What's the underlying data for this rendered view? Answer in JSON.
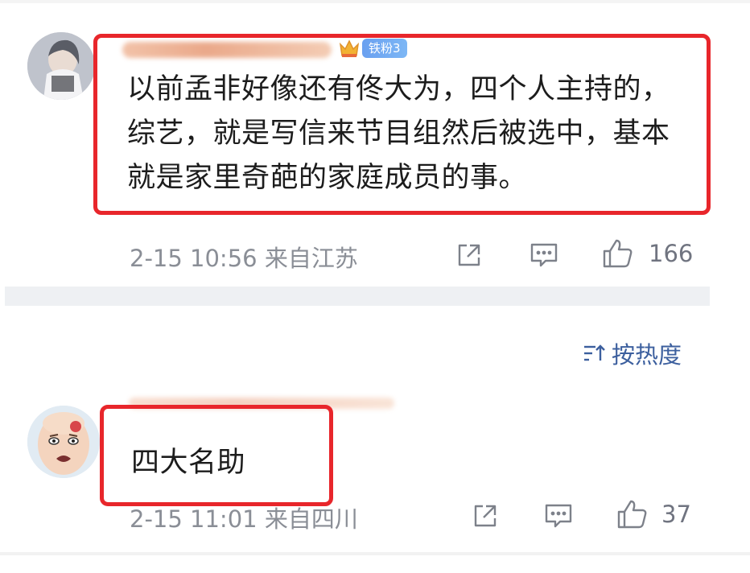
{
  "comments": [
    {
      "badge": "铁粉3",
      "text_lines": [
        "以前孟非好像还有佟大为，四个人主持的，",
        "综艺，就是写信来节目组然后被选中，基本",
        "就是家里奇葩的家庭成员的事。"
      ],
      "time": "2-15 10:56 来自江苏",
      "likes": "166"
    },
    {
      "text": "四大名助",
      "time": "2-15 11:01 来自四川",
      "likes": "37"
    }
  ],
  "sort": {
    "label": "按热度",
    "icon": "sort-lines-icon"
  },
  "icons": [
    "share-icon",
    "comment-icon",
    "like-icon",
    "crown-icon"
  ],
  "colors": {
    "highlight": "#e8262b",
    "meta": "#8a8e96",
    "link": "#3c5f9e",
    "badge": "#6aa0f0"
  }
}
